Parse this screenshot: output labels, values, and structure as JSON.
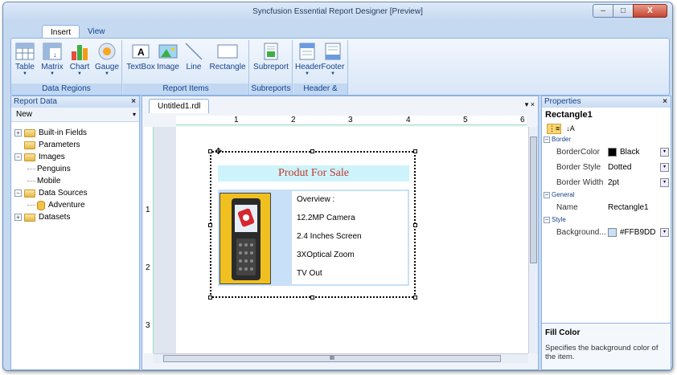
{
  "window": {
    "title": "Syncfusion Essential Report Designer [Preview]",
    "min": "–",
    "max": "□",
    "close": "X"
  },
  "ribbon": {
    "tabs": [
      "Insert",
      "View"
    ],
    "groups": [
      {
        "label": "Data Regions",
        "items": [
          "Table",
          "Matrix",
          "Chart",
          "Gauge"
        ]
      },
      {
        "label": "Report Items",
        "items": [
          "TextBox",
          "Image",
          "Line",
          "Rectangle"
        ]
      },
      {
        "label": "Subreports",
        "items": [
          "Subreport"
        ]
      },
      {
        "label": "Header & Footer",
        "items": [
          "Header",
          "Footer"
        ]
      }
    ]
  },
  "report_data": {
    "title": "Report Data",
    "close": "×",
    "new_label": "New",
    "tree": [
      {
        "label": "Built-in Fields",
        "level": 0,
        "expander": "+",
        "icon": "folder"
      },
      {
        "label": "Parameters",
        "level": 0,
        "expander": "",
        "icon": "folder"
      },
      {
        "label": "Images",
        "level": 0,
        "expander": "−",
        "icon": "folder"
      },
      {
        "label": "Penguins",
        "level": 1,
        "expander": "",
        "icon": ""
      },
      {
        "label": "Mobile",
        "level": 1,
        "expander": "",
        "icon": ""
      },
      {
        "label": "Data Sources",
        "level": 0,
        "expander": "−",
        "icon": "folder"
      },
      {
        "label": "Adventure",
        "level": 1,
        "expander": "",
        "icon": "db"
      },
      {
        "label": "Datasets",
        "level": 0,
        "expander": "+",
        "icon": "folder"
      }
    ]
  },
  "document": {
    "tab": "Untitled1.rdl",
    "ruler_h": [
      "1",
      "2",
      "3",
      "4",
      "5",
      "6"
    ],
    "ruler_v": [
      "1",
      "2",
      "3"
    ],
    "heading": "Produt For Sale",
    "features": [
      "Overview :",
      "12.2MP Camera",
      "2.4 Inches Screen",
      "3XOptical Zoom",
      "TV Out"
    ],
    "scroll_h_label": "III"
  },
  "properties": {
    "title": "Properties",
    "close": "×",
    "selected": "Rectangle1",
    "sections": [
      {
        "name": "Border",
        "rows": [
          {
            "key": "BorderColor",
            "value": "Black",
            "swatch": "#000000",
            "combo": "▾"
          },
          {
            "key": "Border Style",
            "value": "Dotted",
            "combo": "▾"
          },
          {
            "key": "Border Width",
            "value": "2pt",
            "combo": "▾"
          }
        ]
      },
      {
        "name": "General",
        "rows": [
          {
            "key": "Name",
            "value": "Rectangle1"
          }
        ]
      },
      {
        "name": "Style",
        "rows": [
          {
            "key": "Background...",
            "value": "#FFB9DD",
            "swatch": "#c8e0f8",
            "combo": "▾"
          }
        ]
      }
    ],
    "help_title": "Fill Color",
    "help_text": "Specifies the background color of the item."
  }
}
